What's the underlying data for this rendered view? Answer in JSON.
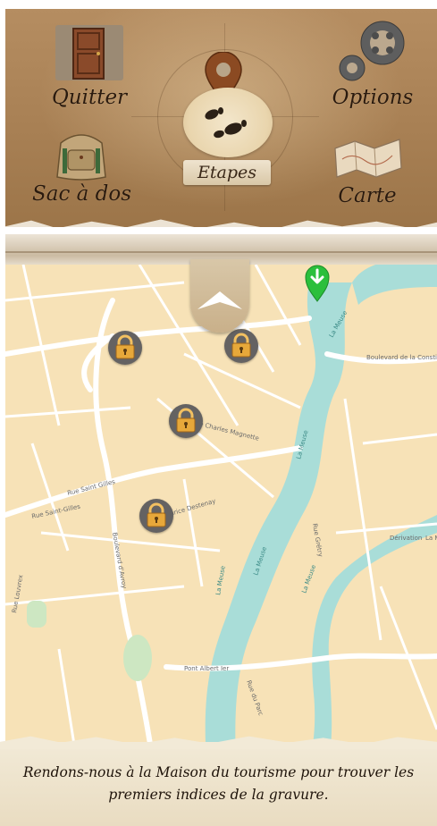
{
  "menu": {
    "quit_label": "Quitter",
    "options_label": "Options",
    "stages_label": "Etapes",
    "bag_label": "Sac à dos",
    "map_label": "Carte"
  },
  "map": {
    "street_labels": [
      "Boulevard de la Constitution",
      "Rue Saint-Gilles",
      "Rue Saint Gilles",
      "Boulevard d'Avroy",
      "Rue Louvrex",
      "Pont Albert Ier",
      "Rue Maurice Destenay",
      "Rue Charles Magnette",
      "Dérivation",
      "La Meuse",
      "Rue du Parc",
      "Rue Grétry"
    ],
    "river_labels": [
      "La Meuse",
      "La Meuse",
      "La Meuse",
      "La Meuse",
      "La Meuse"
    ],
    "locked_stages": 4
  },
  "footer": {
    "line1": "Rendons-nous à la Maison du tourisme pour trouver les",
    "line2": "premiers indices de la gravure."
  },
  "colors": {
    "panel": "#a88054",
    "map_land": "#f7e2b7",
    "river": "#a9ddd8",
    "lock": "#646262",
    "lock_gold": "#e7a83a",
    "pin_green": "#2bbf3c",
    "pin_brown": "#8b4a22"
  },
  "icons": [
    "door-icon",
    "gears-icon",
    "map-pin-icon",
    "footprints-icon",
    "backpack-icon",
    "folded-map-icon",
    "chevron-up-icon",
    "padlock-icon",
    "arrow-down-pin-icon"
  ]
}
